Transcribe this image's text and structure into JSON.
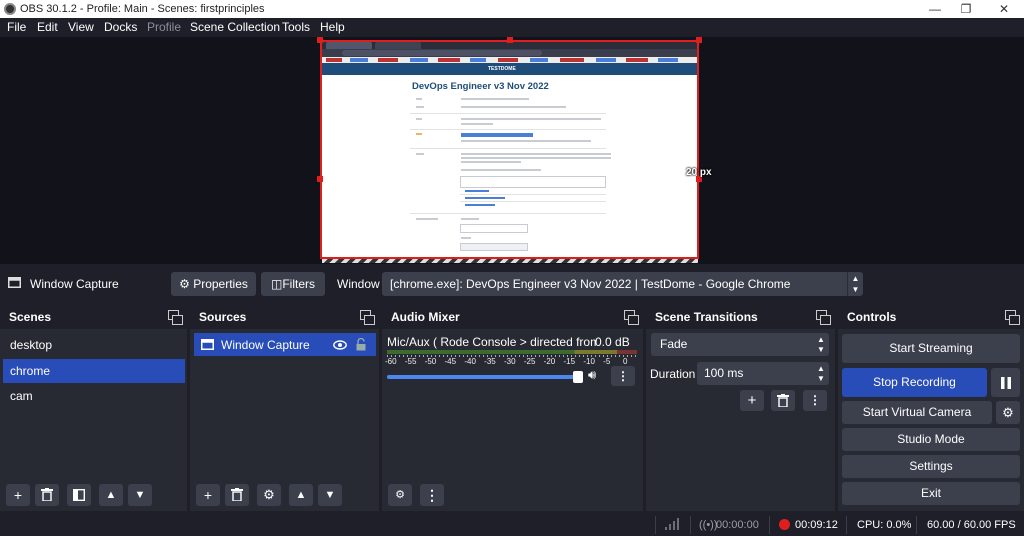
{
  "window": {
    "title": "OBS 30.1.2 - Profile: Main - Scenes: firstprinciples",
    "minimize": "—",
    "maximize": "❐",
    "close": "✕"
  },
  "menu": {
    "file": "File",
    "edit": "Edit",
    "view": "View",
    "docks": "Docks",
    "profile": "Profile",
    "scene_collection": "Scene Collection",
    "tools": "Tools",
    "help": "Help"
  },
  "preview": {
    "page_title": "DevOps Engineer v3 Nov 2022",
    "site_name": "TESTDOME",
    "size_label": "20 px"
  },
  "source_toolbar": {
    "source_name": "Window Capture",
    "properties_label": "Properties",
    "filters_label": "Filters",
    "window_label": "Window",
    "window_value": "[chrome.exe]: DevOps Engineer v3 Nov 2022 | TestDome - Google Chrome"
  },
  "scenes": {
    "title": "Scenes",
    "items": [
      "desktop",
      "chrome",
      "cam"
    ],
    "selected": "chrome"
  },
  "sources": {
    "title": "Sources",
    "items": [
      {
        "name": "Window Capture",
        "visible": true,
        "locked": false
      }
    ]
  },
  "audio_mixer": {
    "title": "Audio Mixer",
    "channel_name": "Mic/Aux ( Rode Console > directed from Voice",
    "db_value": "0.0 dB",
    "scale": [
      "-60",
      "-55",
      "-50",
      "-45",
      "-40",
      "-35",
      "-30",
      "-25",
      "-20",
      "-15",
      "-10",
      "-5",
      "0"
    ],
    "volume_fraction": 1.0
  },
  "scene_transitions": {
    "title": "Scene Transitions",
    "transition": "Fade",
    "duration_label": "Duration",
    "duration_value": "100 ms"
  },
  "controls": {
    "title": "Controls",
    "start_streaming": "Start Streaming",
    "stop_recording": "Stop Recording",
    "start_virtual_camera": "Start Virtual Camera",
    "studio_mode": "Studio Mode",
    "settings": "Settings",
    "exit": "Exit"
  },
  "status": {
    "stream_time": "00:00:00",
    "rec_time": "00:09:12",
    "cpu": "CPU: 0.0%",
    "fps": "60.00 / 60.00 FPS"
  },
  "colors": {
    "accent": "#284cb8",
    "record": "#e01e1e",
    "panel": "#272a33",
    "background": "#1e1f29"
  }
}
